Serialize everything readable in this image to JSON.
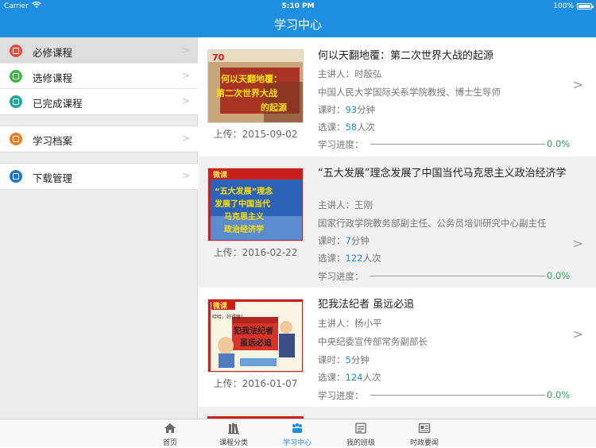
{
  "status_bar": {
    "carrier": "Carrier",
    "time": "5:10 PM",
    "battery": "100%"
  },
  "nav": {
    "title": "学习中心"
  },
  "sidebar": {
    "items": [
      {
        "label": "必修课程",
        "icon": "required-course-icon",
        "color": "#e2503f",
        "active": true
      },
      {
        "label": "选修课程",
        "icon": "elective-course-icon",
        "color": "#45b549",
        "active": false
      },
      {
        "label": "已完成课程",
        "icon": "completed-course-icon",
        "color": "#23a99a",
        "active": false
      },
      {
        "label": "学习档案",
        "icon": "archive-icon",
        "color": "#ef7d1e",
        "active": false
      },
      {
        "label": "下载管理",
        "icon": "download-icon",
        "color": "#1e78c8",
        "active": false
      }
    ]
  },
  "courses": [
    {
      "title": "何以天翻地覆：第二次世界大战的起源",
      "lecturer_label": "主讲人：",
      "lecturer": "时殷弘",
      "affiliation": "中国人民大学国际关系学院教授、博士生导师",
      "hours_label": "课时：",
      "hours": "93",
      "hours_unit": "分钟",
      "enroll_label": "选课：",
      "enroll": "58",
      "enroll_unit": "人次",
      "progress_label": "学习进度：",
      "progress": "0.0%",
      "upload": "上传：2015-09-02",
      "thumb_badge": "70",
      "thumb_lines": [
        "何以天翻地覆：",
        "第二次世界大战",
        "的起源"
      ]
    },
    {
      "title": "“五大发展”理念发展了中国当代马克思主义政治经济学",
      "lecturer_label": "主讲人：",
      "lecturer": "王刚",
      "affiliation": "国家行政学院教务部副主任、公务员培训研究中心副主任",
      "hours_label": "课时：",
      "hours": "7",
      "hours_unit": "分钟",
      "enroll_label": "选课：",
      "enroll": "122",
      "enroll_unit": "人次",
      "progress_label": "学习进度：",
      "progress": "0.0%",
      "upload": "上传：2016-02-22",
      "thumb_badge": "微课",
      "thumb_lines": [
        "“五大发展”理念",
        "发展了中国当代",
        "马克思主义",
        "政治经济学"
      ]
    },
    {
      "title": "犯我法纪者 虽远必追",
      "lecturer_label": "主讲人：",
      "lecturer": "杨小平",
      "affiliation": "中央纪委宣传部常务副部长",
      "hours_label": "课时：",
      "hours": "5",
      "hours_unit": "分钟",
      "enroll_label": "选课：",
      "enroll": "124",
      "enroll_unit": "人次",
      "progress_label": "学习进度：",
      "progress": "0.0%",
      "upload": "上传：2016-01-07",
      "thumb_badge": "微课",
      "thumb_lines": [
        "犯我法纪者",
        "虽远必追"
      ],
      "thumb_speech": "哈哈，好得嘛！"
    }
  ],
  "tabs": [
    {
      "label": "首页",
      "icon": "home-icon",
      "active": false
    },
    {
      "label": "课程分类",
      "icon": "books-icon",
      "active": false
    },
    {
      "label": "学习中心",
      "icon": "study-center-icon",
      "active": true
    },
    {
      "label": "我的班级",
      "icon": "class-icon",
      "active": false
    },
    {
      "label": "时政要闻",
      "icon": "news-icon",
      "active": false
    }
  ],
  "colors": {
    "accent": "#1e8fe0",
    "progress": "#2aa65a"
  }
}
